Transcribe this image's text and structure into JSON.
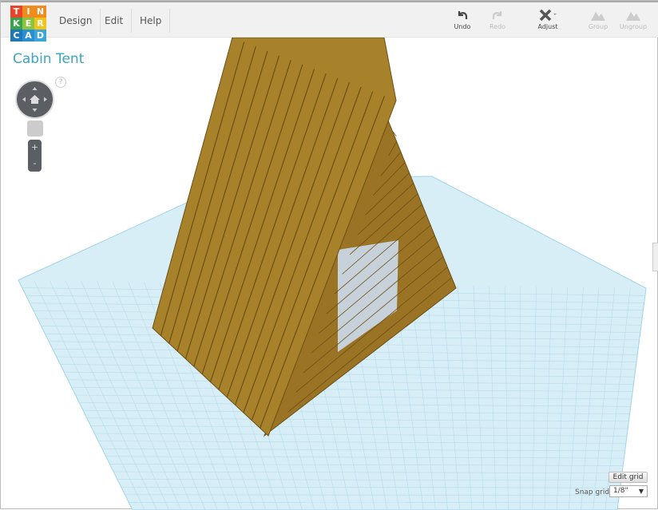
{
  "logo": {
    "letters": [
      "T",
      "I",
      "N",
      "K",
      "E",
      "R",
      "C",
      "A",
      "D"
    ],
    "colors": [
      "#e8442a",
      "#f08c1d",
      "#f08c1d",
      "#3ca24a",
      "#8bc43f",
      "#f0c419",
      "#1f77b8",
      "#2b8ed1",
      "#3aa6dc"
    ]
  },
  "menu": [
    {
      "label": "Design"
    },
    {
      "label": "Edit"
    },
    {
      "label": "Help"
    }
  ],
  "toolbar": {
    "undo": "Undo",
    "redo": "Redo",
    "adjust": "Adjust",
    "group": "Group",
    "ungroup": "Ungroup"
  },
  "design_title": "Cabin Tent",
  "view_controls": {
    "help": "?",
    "zoom_in": "+",
    "zoom_out": "-"
  },
  "grid": {
    "edit_grid": "Edit grid",
    "snap_label": "Snap grid",
    "snap_value": "1/8\""
  },
  "colors": {
    "accent": "#3aa6c0",
    "wood": "#a8822a",
    "grid": "#cfe8f3"
  }
}
